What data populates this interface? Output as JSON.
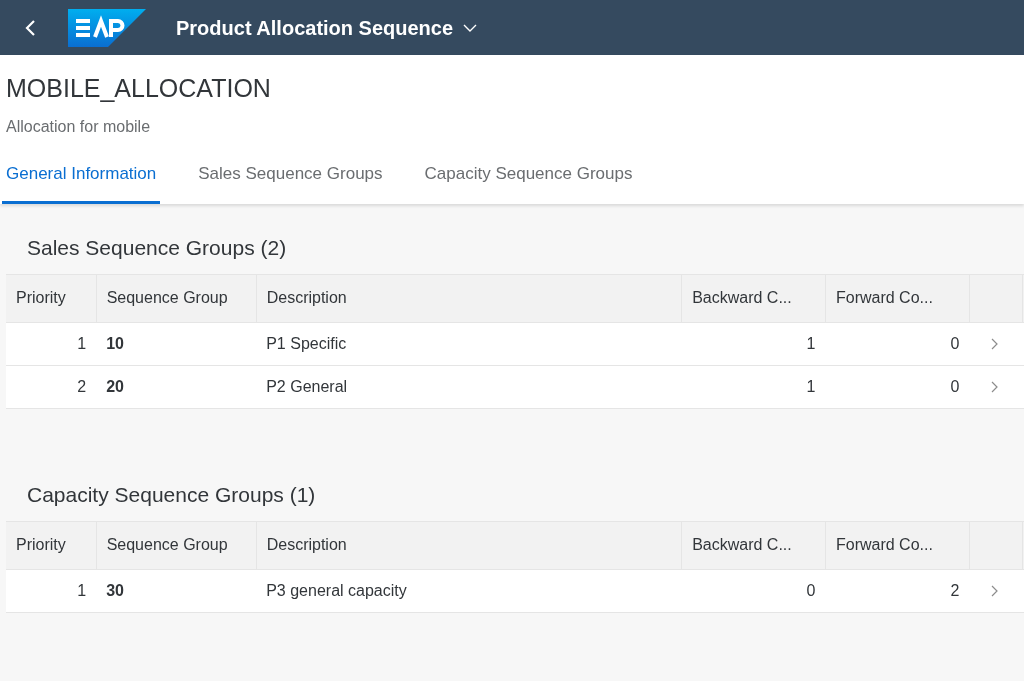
{
  "shell": {
    "title": "Product Allocation Sequence"
  },
  "header": {
    "title": "MOBILE_ALLOCATION",
    "subtitle": "Allocation for mobile"
  },
  "tabs": [
    {
      "label": "General Information",
      "selected": true
    },
    {
      "label": "Sales Sequence Groups",
      "selected": false
    },
    {
      "label": "Capacity Sequence Groups",
      "selected": false
    }
  ],
  "sections": [
    {
      "title": "Sales Sequence Groups (2)",
      "columns": [
        "Priority",
        "Sequence Group",
        "Description",
        "Backward C...",
        "Forward Co..."
      ],
      "rows": [
        [
          "1",
          "10",
          "P1 Specific",
          "1",
          "0"
        ],
        [
          "2",
          "20",
          "P2 General",
          "1",
          "0"
        ]
      ]
    },
    {
      "title": "Capacity Sequence Groups (1)",
      "columns": [
        "Priority",
        "Sequence Group",
        "Description",
        "Backward C...",
        "Forward Co..."
      ],
      "rows": [
        [
          "1",
          "30",
          "P3 general capacity",
          "0",
          "2"
        ]
      ]
    }
  ]
}
